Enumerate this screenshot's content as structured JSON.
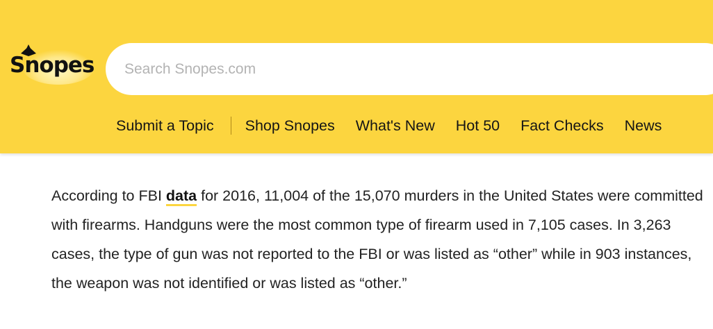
{
  "header": {
    "brand": "Snopes",
    "background_color": "#fcd53f",
    "search": {
      "placeholder": "Search Snopes.com",
      "value": ""
    },
    "nav": {
      "items": [
        {
          "label": "Submit a Topic"
        },
        {
          "label": "Shop Snopes"
        },
        {
          "label": "What's New"
        },
        {
          "label": "Hot 50"
        },
        {
          "label": "Fact Checks"
        },
        {
          "label": "News"
        }
      ]
    }
  },
  "article": {
    "text_before_link": "According to FBI ",
    "link_text": "data",
    "text_after_link": " for 2016, 11,004 of the 15,070 murders in the United States were committed with firearms. Handguns were the most common type of firearm used in 7,105 cases. In 3,263 cases, the type of gun was not reported to the FBI or was listed as “other” while in 903 instances, the weapon was not identified or was listed as “other.”",
    "link_underline_color": "#fcd53f"
  }
}
